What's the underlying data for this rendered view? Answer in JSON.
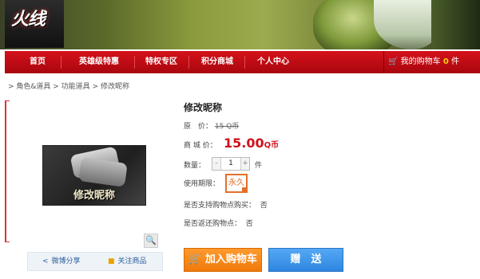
{
  "banner": {
    "logo": "火线"
  },
  "nav": {
    "items": [
      "首页",
      "英雄级特惠",
      "特权专区",
      "积分商城",
      "个人中心"
    ],
    "cart_label": "我的购物车",
    "cart_count": "0",
    "cart_unit": "件"
  },
  "breadcrumb": "> 角色&道具 > 功能道具 > 修改昵称",
  "product": {
    "image_caption": "修改昵称",
    "title": "修改昵称",
    "original_label": "原　价：",
    "original_price": "15 Q币",
    "mall_label": "商 城 价：",
    "price": "15.00",
    "price_unit": "Q币",
    "quantity_label": "数量：",
    "quantity": "1",
    "quantity_unit": "件",
    "period_label": "使用期限：",
    "period_value": "永久",
    "points_pay_label": "是否支持购物点购买：",
    "points_pay_value": "否",
    "points_back_label": "是否返还购物点：",
    "points_back_value": "否"
  },
  "share": {
    "weibo": "微博分享",
    "follow": "关注商品"
  },
  "buttons": {
    "add_to_cart": "加入购物车",
    "gift": "赠　送"
  },
  "colors": {
    "nav_red": "#c80d16",
    "price_red": "#d0101a",
    "cart_orange": "#f58a1d",
    "gift_blue": "#3d93e8"
  }
}
